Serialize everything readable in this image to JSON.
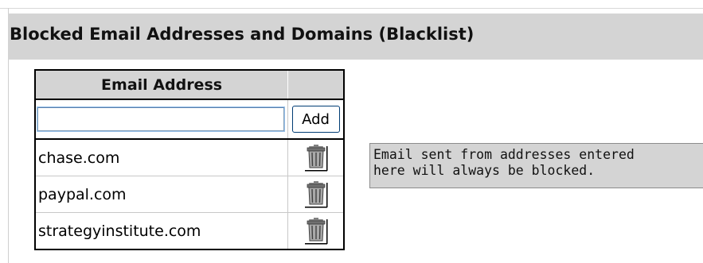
{
  "section": {
    "title": "Blocked Email Addresses and Domains (Blacklist)"
  },
  "table": {
    "column_header": "Email Address",
    "action_header": "",
    "input": {
      "value": "",
      "placeholder": ""
    },
    "add_label": "Add",
    "rows": [
      {
        "address": "chase.com",
        "delete_icon": "trash-icon"
      },
      {
        "address": "paypal.com",
        "delete_icon": "trash-icon"
      },
      {
        "address": "strategyinstitute.com",
        "delete_icon": "trash-icon"
      }
    ]
  },
  "info": {
    "lines": [
      "Email sent from addresses entered",
      "here will always be blocked."
    ]
  },
  "colors": {
    "header_bg": "#d4d4d4",
    "table_border": "#000000",
    "input_border": "#7f9db9"
  }
}
